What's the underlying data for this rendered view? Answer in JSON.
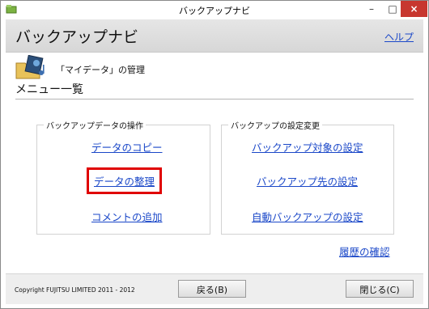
{
  "window": {
    "title": "バックアップナビ",
    "minimize": "–",
    "maximize": "□",
    "close": "×"
  },
  "header": {
    "title": "バックアップナビ",
    "help_link": "ヘルプ"
  },
  "section": {
    "label": "「マイデータ」の管理",
    "menu_heading": "メニュー一覧"
  },
  "groups": {
    "left": {
      "title": "バックアップデータの操作",
      "links": [
        "データのコピー",
        "データの整理",
        "コメントの追加"
      ]
    },
    "right": {
      "title": "バックアップの設定変更",
      "links": [
        "バックアップ対象の設定",
        "バックアップ先の設定",
        "自動バックアップの設定"
      ]
    }
  },
  "history_link": "履歴の確認",
  "footer": {
    "copyright": "Copyright FUJITSU LIMITED 2011 - 2012",
    "back_button": "戻る(B)",
    "close_button": "閉じる(C)"
  },
  "highlight_color": "#e00000",
  "link_color": "#1a47c8",
  "icons": {
    "app": "backup-app-icon",
    "folder": "folder-music-icon"
  }
}
